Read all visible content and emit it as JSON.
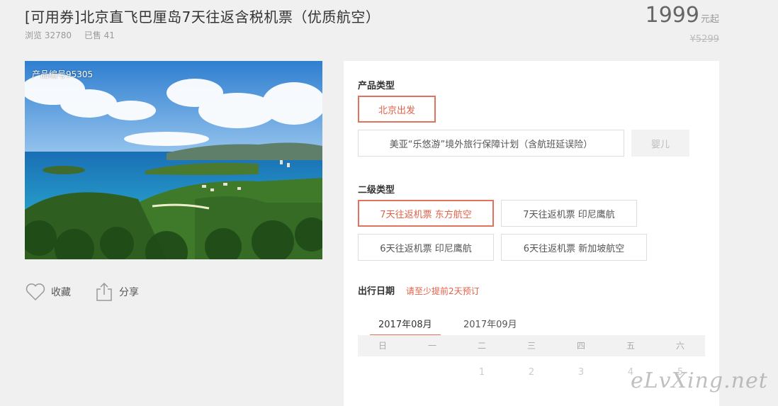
{
  "product": {
    "title": "[可用券]北京直飞巴厘岛7天往返含税机票（优质航空）",
    "views": "浏览 32780",
    "sold": "已售 41",
    "price": "1999",
    "price_unit": "元起",
    "original_price": "¥5299",
    "code": "产品编号95305"
  },
  "actions": {
    "favorite": "收藏",
    "share": "分享"
  },
  "product_type": {
    "label": "产品类型",
    "options": [
      "北京出发",
      "美亚“乐悠游”境外旅行保障计划（含航班延误险）",
      "婴儿"
    ]
  },
  "sub_type": {
    "label": "二级类型",
    "options": [
      "7天往返机票 东方航空",
      "7天往返机票 印尼鹰航",
      "6天往返机票 印尼鹰航",
      "6天往返机票 新加坡航空"
    ]
  },
  "travel_date": {
    "label": "出行日期",
    "hint": "请至少提前2天预订",
    "months": [
      "2017年08月",
      "2017年09月"
    ],
    "weekdays": [
      "日",
      "一",
      "二",
      "三",
      "四",
      "五",
      "六"
    ],
    "first_row": [
      "",
      "",
      "1",
      "2",
      "3",
      "4",
      "5"
    ]
  },
  "watermark": "eLvXing.net",
  "colors": {
    "accent": "#e0624a",
    "bg": "#f0f0f0"
  }
}
